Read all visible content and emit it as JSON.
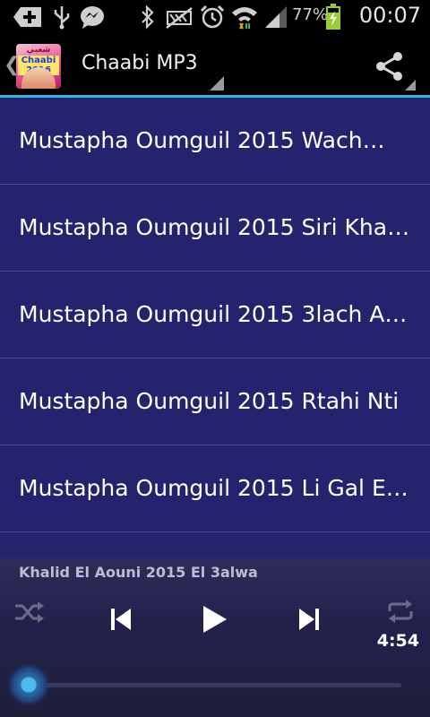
{
  "status_bar": {
    "battery_percent": "77%",
    "clock": "00:07",
    "icons": [
      "add-icon",
      "usb-icon",
      "messenger-icon",
      "bluetooth-icon",
      "mute-icon",
      "alarm-icon",
      "wifi-icon",
      "signal-icon",
      "battery-charging-icon"
    ]
  },
  "action_bar": {
    "title": "Chaabi MP3",
    "app_icon": {
      "top_text": "شعبي مغربي",
      "mid_text": "Chaabi 2016"
    },
    "share_icon": "share-icon"
  },
  "songs": [
    "Mustapha Oumguil 2015 Wach…",
    "Mustapha Oumguil 2015 Siri Kha…",
    "Mustapha Oumguil 2015 3lach A…",
    "Mustapha Oumguil 2015 Rtahi Nti",
    "Mustapha Oumguil 2015 Li Gal E…"
  ],
  "player": {
    "now_playing": "Khalid El Aouni 2015 El 3alwa",
    "time": "4:54",
    "progress": 0.0,
    "accent": "#33b5e5"
  }
}
